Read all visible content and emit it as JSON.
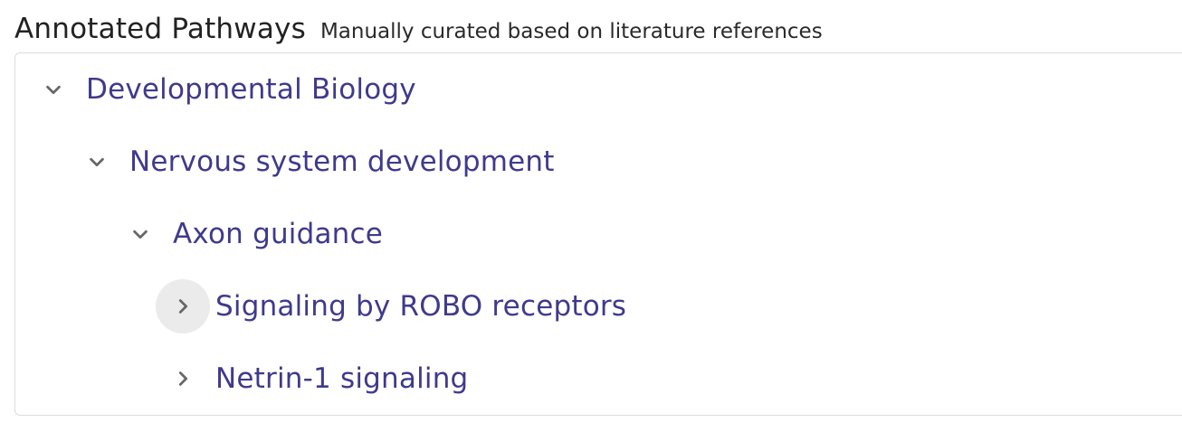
{
  "section": {
    "title": "Annotated Pathways",
    "subtitle": "Manually curated based on literature references"
  },
  "tree": {
    "nodes": [
      {
        "label": "Developmental Biology",
        "level": 0,
        "state": "expanded",
        "icon": "chevron-down-icon"
      },
      {
        "label": "Nervous system development",
        "level": 1,
        "state": "expanded",
        "icon": "chevron-down-icon"
      },
      {
        "label": "Axon guidance",
        "level": 2,
        "state": "expanded",
        "icon": "chevron-down-icon"
      },
      {
        "label": "Signaling by ROBO receptors",
        "level": 3,
        "state": "collapsed",
        "icon": "chevron-right-icon",
        "hovered": true
      },
      {
        "label": "Netrin-1 signaling",
        "level": 3,
        "state": "collapsed",
        "icon": "chevron-right-icon"
      }
    ]
  },
  "colors": {
    "link": "#3f3a8c",
    "icon": "#666666",
    "hover_bg": "#ebebeb",
    "border": "#dcdcdc"
  }
}
